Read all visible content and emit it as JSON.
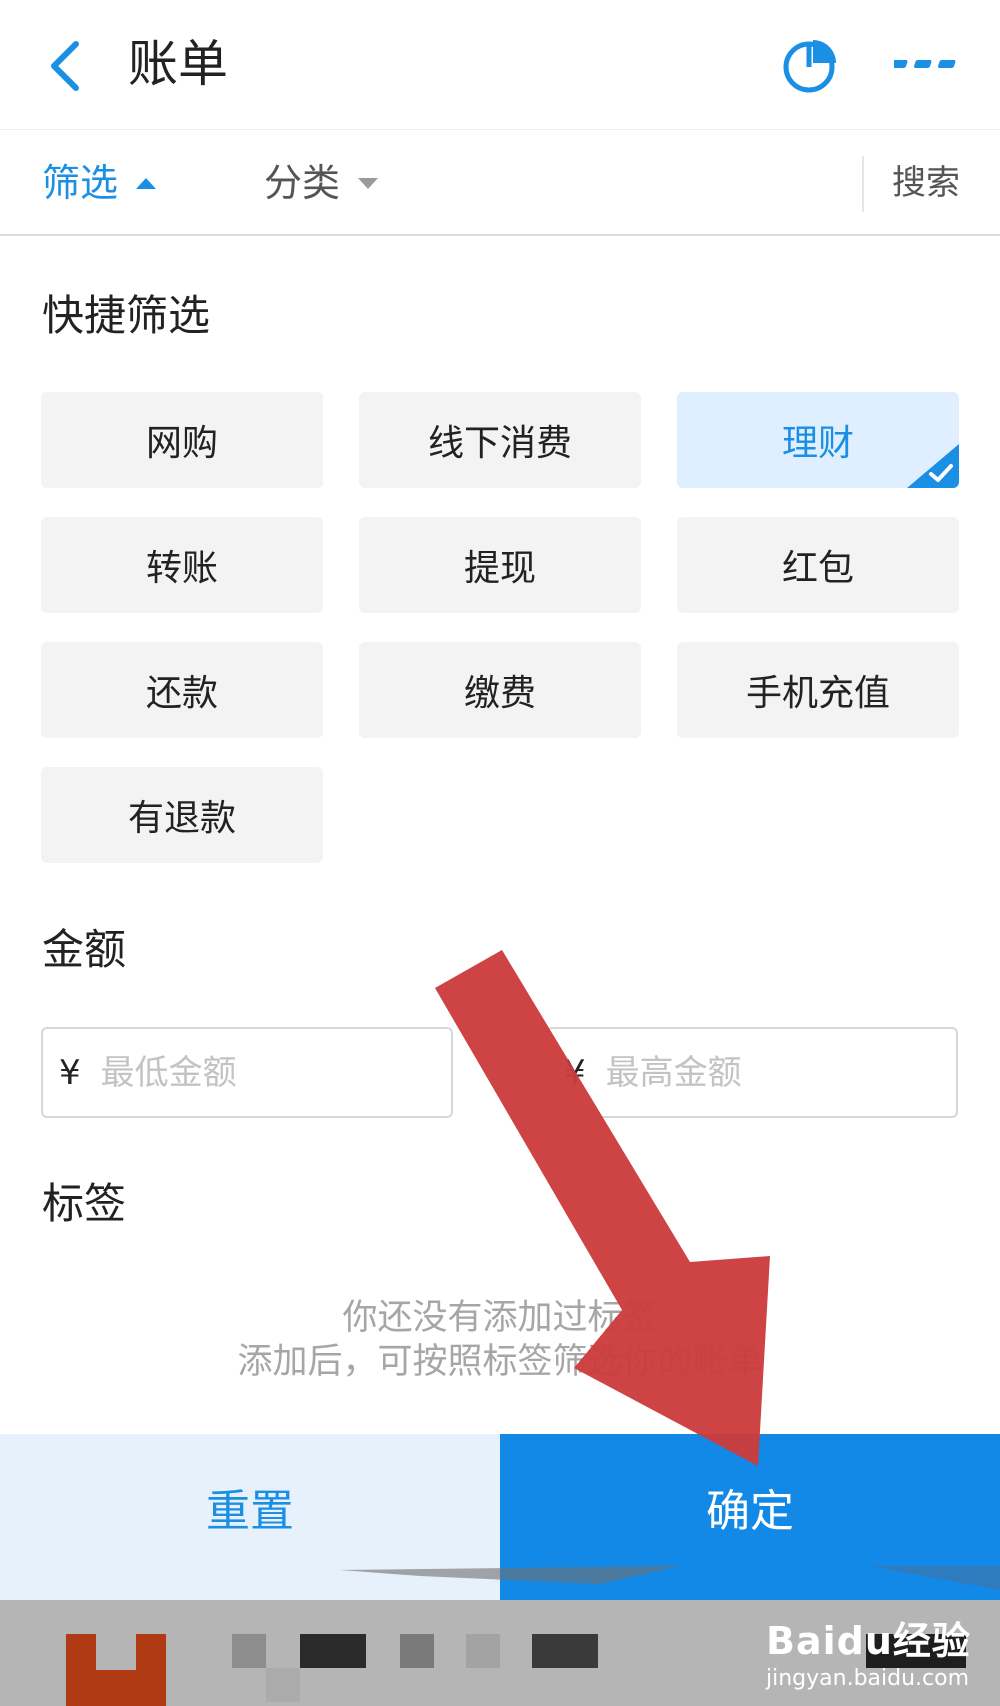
{
  "header": {
    "title": "账单",
    "back_icon": "back-arrow-icon",
    "chart_icon": "pie-chart-icon",
    "more_icon": "more-dots-icon",
    "accent_color": "#1a8fe3"
  },
  "filter_bar": {
    "tabs": [
      {
        "label": "筛选",
        "state": "active"
      },
      {
        "label": "分类",
        "state": "inactive"
      }
    ],
    "search_label": "搜索"
  },
  "quick_filter": {
    "title": "快捷筛选",
    "chips": [
      {
        "label": "网购",
        "selected": false
      },
      {
        "label": "线下消费",
        "selected": false
      },
      {
        "label": "理财",
        "selected": true
      },
      {
        "label": "转账",
        "selected": false
      },
      {
        "label": "提现",
        "selected": false
      },
      {
        "label": "红包",
        "selected": false
      },
      {
        "label": "还款",
        "selected": false
      },
      {
        "label": "缴费",
        "selected": false
      },
      {
        "label": "手机充值",
        "selected": false
      },
      {
        "label": "有退款",
        "selected": false
      }
    ]
  },
  "amount": {
    "title": "金额",
    "currency_symbol": "¥",
    "min_placeholder": "最低金额",
    "max_placeholder": "最高金额",
    "min_value": "",
    "max_value": ""
  },
  "tags": {
    "title": "标签",
    "empty_line1": "你还没有添加过标签",
    "empty_line2": "添加后，可按照标签筛选你的账单"
  },
  "actions": {
    "reset_label": "重置",
    "confirm_label": "确定",
    "confirm_color": "#1289e6",
    "reset_bg": "#e7f1fb"
  },
  "annotation": {
    "arrow_color": "#cc3b3b"
  },
  "watermark": {
    "logo_text": "Baidu经验",
    "url_text": "jingyan.baidu.com"
  }
}
